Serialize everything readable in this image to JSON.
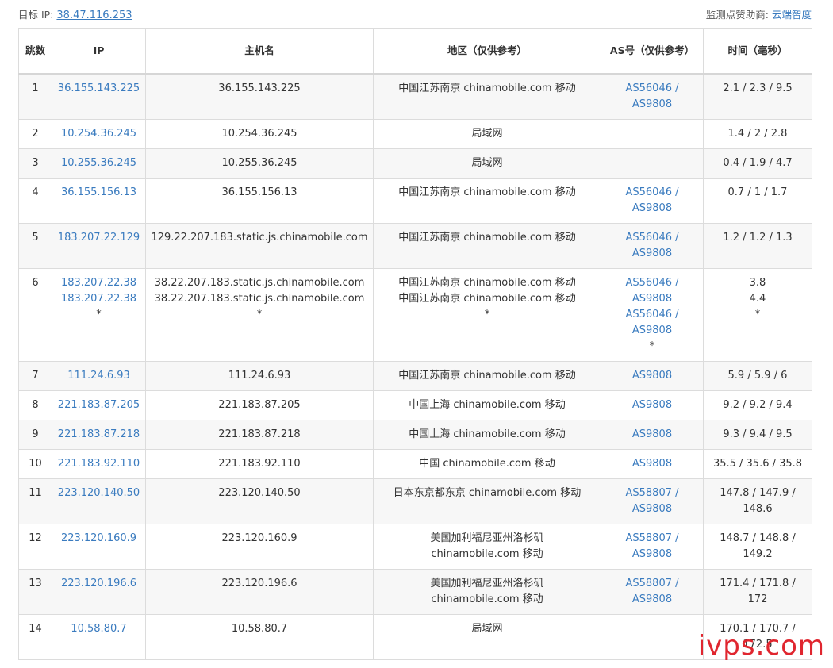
{
  "header": {
    "target_label": "目标 IP:",
    "target_ip": "38.47.116.253",
    "sponsor_label": "监测点赞助商:",
    "sponsor_name": "云端智度"
  },
  "columns": [
    "跳数",
    "IP",
    "主机名",
    "地区（仅供参考）",
    "AS号（仅供参考）",
    "时间（毫秒）"
  ],
  "rows": [
    {
      "hop": "1",
      "ip": [
        "36.155.143.225"
      ],
      "host": [
        "36.155.143.225"
      ],
      "region": [
        "中国江苏南京 chinamobile.com 移动"
      ],
      "as": [
        "AS56046 /",
        "AS9808"
      ],
      "time": [
        "2.1 / 2.3 / 9.5"
      ]
    },
    {
      "hop": "2",
      "ip": [
        "10.254.36.245"
      ],
      "host": [
        "10.254.36.245"
      ],
      "region": [
        "局域网"
      ],
      "as": [],
      "time": [
        "1.4 / 2 / 2.8"
      ]
    },
    {
      "hop": "3",
      "ip": [
        "10.255.36.245"
      ],
      "host": [
        "10.255.36.245"
      ],
      "region": [
        "局域网"
      ],
      "as": [],
      "time": [
        "0.4 / 1.9 / 4.7"
      ]
    },
    {
      "hop": "4",
      "ip": [
        "36.155.156.13"
      ],
      "host": [
        "36.155.156.13"
      ],
      "region": [
        "中国江苏南京 chinamobile.com 移动"
      ],
      "as": [
        "AS56046 /",
        "AS9808"
      ],
      "time": [
        "0.7 / 1 / 1.7"
      ]
    },
    {
      "hop": "5",
      "ip": [
        "183.207.22.129"
      ],
      "host": [
        "129.22.207.183.static.js.chinamobile.com"
      ],
      "region": [
        "中国江苏南京 chinamobile.com 移动"
      ],
      "as": [
        "AS56046 /",
        "AS9808"
      ],
      "time": [
        "1.2 / 1.2 / 1.3"
      ]
    },
    {
      "hop": "6",
      "ip": [
        "183.207.22.38",
        "183.207.22.38",
        "*"
      ],
      "host": [
        "38.22.207.183.static.js.chinamobile.com",
        "38.22.207.183.static.js.chinamobile.com",
        "*"
      ],
      "region": [
        "中国江苏南京 chinamobile.com 移动",
        "中国江苏南京 chinamobile.com 移动",
        "*"
      ],
      "as": [
        "AS56046 /",
        "AS9808",
        "AS56046 /",
        "AS9808",
        "*"
      ],
      "time": [
        "3.8",
        "4.4",
        "*"
      ]
    },
    {
      "hop": "7",
      "ip": [
        "111.24.6.93"
      ],
      "host": [
        "111.24.6.93"
      ],
      "region": [
        "中国江苏南京 chinamobile.com 移动"
      ],
      "as": [
        "AS9808"
      ],
      "time": [
        "5.9 / 5.9 / 6"
      ]
    },
    {
      "hop": "8",
      "ip": [
        "221.183.87.205"
      ],
      "host": [
        "221.183.87.205"
      ],
      "region": [
        "中国上海 chinamobile.com 移动"
      ],
      "as": [
        "AS9808"
      ],
      "time": [
        "9.2 / 9.2 / 9.4"
      ]
    },
    {
      "hop": "9",
      "ip": [
        "221.183.87.218"
      ],
      "host": [
        "221.183.87.218"
      ],
      "region": [
        "中国上海 chinamobile.com 移动"
      ],
      "as": [
        "AS9808"
      ],
      "time": [
        "9.3 / 9.4 / 9.5"
      ]
    },
    {
      "hop": "10",
      "ip": [
        "221.183.92.110"
      ],
      "host": [
        "221.183.92.110"
      ],
      "region": [
        "中国 chinamobile.com 移动"
      ],
      "as": [
        "AS9808"
      ],
      "time": [
        "35.5 / 35.6 / 35.8"
      ]
    },
    {
      "hop": "11",
      "ip": [
        "223.120.140.50"
      ],
      "host": [
        "223.120.140.50"
      ],
      "region": [
        "日本东京都东京 chinamobile.com 移动"
      ],
      "as": [
        "AS58807 /",
        "AS9808"
      ],
      "time": [
        "147.8 / 147.9 /",
        "148.6"
      ]
    },
    {
      "hop": "12",
      "ip": [
        "223.120.160.9"
      ],
      "host": [
        "223.120.160.9"
      ],
      "region": [
        "美国加利福尼亚州洛杉矶",
        "chinamobile.com 移动"
      ],
      "as": [
        "AS58807 /",
        "AS9808"
      ],
      "time": [
        "148.7 / 148.8 /",
        "149.2"
      ]
    },
    {
      "hop": "13",
      "ip": [
        "223.120.196.6"
      ],
      "host": [
        "223.120.196.6"
      ],
      "region": [
        "美国加利福尼亚州洛杉矶",
        "chinamobile.com 移动"
      ],
      "as": [
        "AS58807 /",
        "AS9808"
      ],
      "time": [
        "171.4 / 171.8 /",
        "172"
      ]
    },
    {
      "hop": "14",
      "ip": [
        "10.58.80.7"
      ],
      "host": [
        "10.58.80.7"
      ],
      "region": [
        "局域网"
      ],
      "as": [],
      "time": [
        "170.1 / 170.7 /",
        "172.5"
      ]
    }
  ],
  "watermark": "ivps.com",
  "colors": {
    "link": "#3a7bbf",
    "watermark": "#e0262f",
    "row_alt": "#f7f7f7",
    "border": "#dcdcdc"
  }
}
